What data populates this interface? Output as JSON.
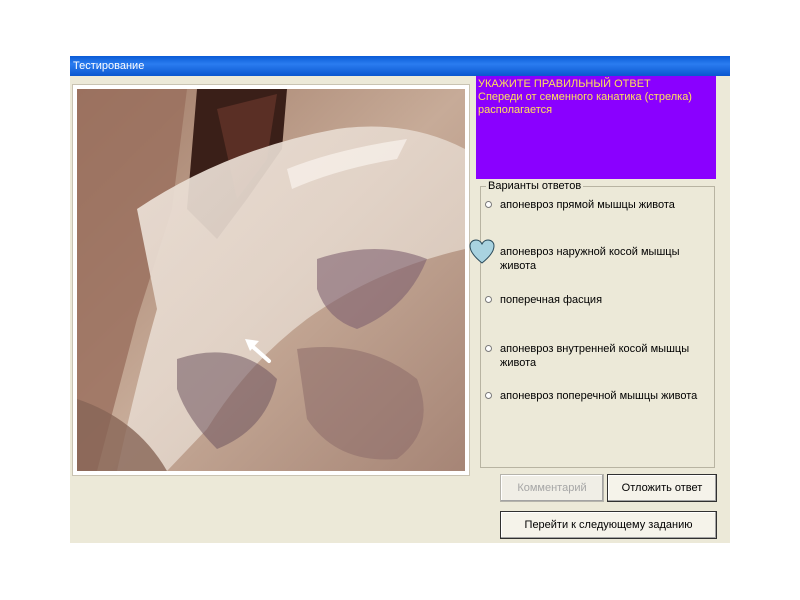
{
  "window": {
    "title": "Тестирование"
  },
  "question": {
    "heading": "УКАЖИТЕ ПРАВИЛЬНЫЙ ОТВЕТ",
    "text": "Спереди от семенного канатика (стрелка) располагается"
  },
  "answers": {
    "legend": "Варианты ответов",
    "options": [
      {
        "label": "апоневроз прямой мышцы живота",
        "selected": false
      },
      {
        "label": "апоневроз наружной косой мышцы живота",
        "selected": true
      },
      {
        "label": "поперечная фасция",
        "selected": false
      },
      {
        "label": "апоневроз внутренней косой мышцы живота",
        "selected": false
      },
      {
        "label": "апоневроз поперечной мышцы живота",
        "selected": false
      }
    ]
  },
  "buttons": {
    "comment": "Комментарий",
    "postpone": "Отложить ответ",
    "next": "Перейти к следующему заданию"
  },
  "colors": {
    "title_bar": "#0a5bd6",
    "question_bg": "#8a00ff",
    "question_text": "#ffe05a",
    "window_bg": "#ece9d8",
    "heart_marker": "#a9d3e0"
  },
  "icons": {
    "selected_marker": "heart-icon",
    "photo_pointer": "arrow-icon"
  }
}
